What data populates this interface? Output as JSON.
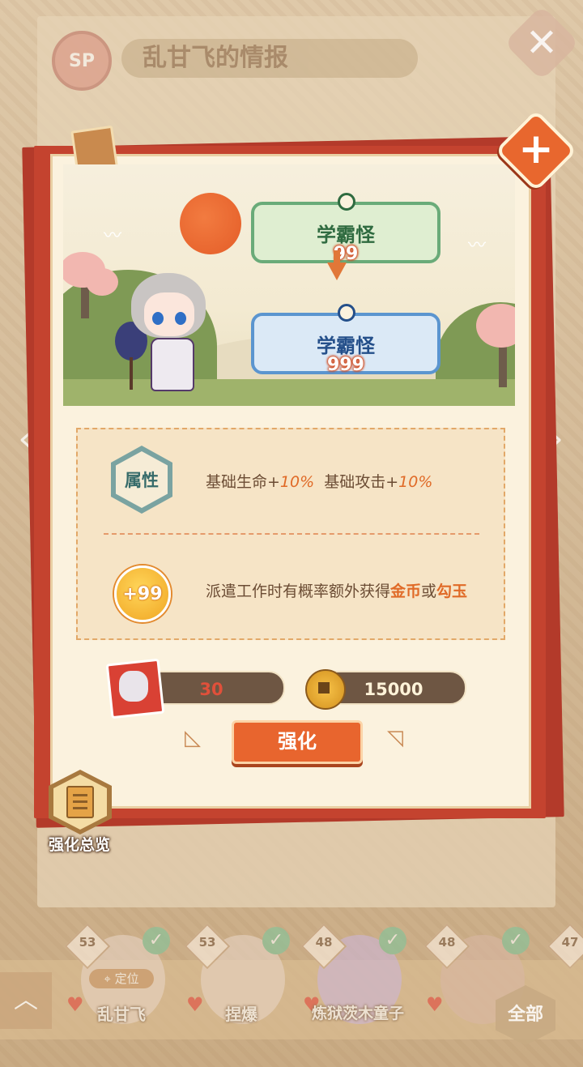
{
  "header": {
    "badge": "SP",
    "title": "乱甘飞的情报"
  },
  "upgrade": {
    "from_name": "学霸怪",
    "from_level": "99",
    "to_name": "学霸怪",
    "to_level": "999"
  },
  "attributes": {
    "label": "属性",
    "hp_text": "基础生命+",
    "hp_value": "10%",
    "atk_text": "基础攻击+",
    "atk_value": "10%"
  },
  "effect": {
    "icon_text": "+99",
    "text_prefix": "派遣工作时有概率额外获得",
    "gold": "金币",
    "conj": "或",
    "jade": "勾玉"
  },
  "costs": {
    "shards": "30",
    "gold": "15000"
  },
  "actions": {
    "enhance": "强化",
    "overview": "强化总览"
  },
  "roster": {
    "locate": "定位",
    "all": "全部",
    "items": [
      {
        "level": "53",
        "name": "乱甘飞"
      },
      {
        "level": "53",
        "name": "捏爆"
      },
      {
        "level": "48",
        "name": "炼狱茨木童子"
      },
      {
        "level": "48",
        "name": ""
      },
      {
        "level": "47",
        "name": ""
      }
    ]
  },
  "colors": {
    "accent": "#e8652e",
    "card_red": "#c4432f",
    "green": "#6aab79",
    "blue": "#5b95cf"
  },
  "icons": [
    "close-icon",
    "sun-icon",
    "arrow-down-icon",
    "gold-coin-icon",
    "soul-shard-icon",
    "document-icon",
    "check-icon",
    "location-icon"
  ]
}
